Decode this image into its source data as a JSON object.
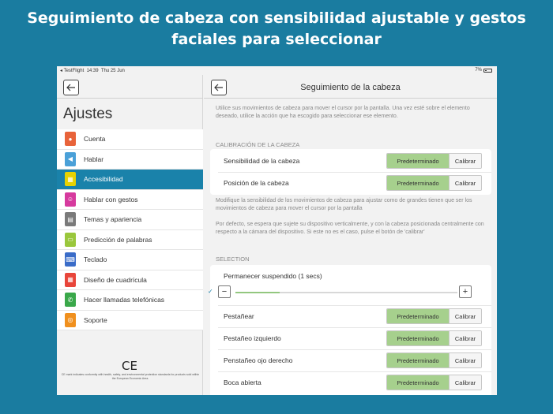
{
  "headline": {
    "line1": "Seguimiento de cabeza con sensibilidad ajustable y gestos",
    "line2": "faciales para seleccionar"
  },
  "statusbar": {
    "app": "◂ TestFlight",
    "time": "14:39",
    "date": "Thu 25 Jun",
    "battery": "7%"
  },
  "sidebar": {
    "title": "Ajustes",
    "items": [
      {
        "label": "Cuenta",
        "icon": "person-icon",
        "color": "#e8633a"
      },
      {
        "label": "Hablar",
        "icon": "speaker-icon",
        "color": "#4aa0d8"
      },
      {
        "label": "Accesibilidad",
        "icon": "grid-icon",
        "color": "#e8d200"
      },
      {
        "label": "Hablar con gestos",
        "icon": "gesture-icon",
        "color": "#d63a9e"
      },
      {
        "label": "Temas y apariencia",
        "icon": "theme-icon",
        "color": "#7a7a7a"
      },
      {
        "label": "Predicción de palabras",
        "icon": "prediction-icon",
        "color": "#9ac73c"
      },
      {
        "label": "Teclado",
        "icon": "keyboard-icon",
        "color": "#3a6cc8"
      },
      {
        "label": "Diseño de cuadrícula",
        "icon": "layout-icon",
        "color": "#e8453a"
      },
      {
        "label": "Hacer llamadas telefónicas",
        "icon": "phone-icon",
        "color": "#3aa84a"
      },
      {
        "label": "Soporte",
        "icon": "support-icon",
        "color": "#f0901e"
      }
    ],
    "active_index": 2,
    "ce_mark": "CE",
    "ce_text": "CE mark indicates conformity with health, safety, and environmental protection standards for products sold within the European Economic Area."
  },
  "detail": {
    "title": "Seguimiento de la cabeza",
    "intro": "Utilice sus movimientos de cabeza para mover el cursor por la pantalla. Una vez esté sobre el elemento deseado, utilice la acción que ha escogido para seleccionar ese elemento.",
    "calibration_header": "CALIBRACIÓN DE LA CABEZA",
    "calibration_rows": [
      {
        "label": "Sensibilidad de la cabeza",
        "opt_a": "Predeterminado",
        "opt_b": "Calibrar"
      },
      {
        "label": "Posición de la cabeza",
        "opt_a": "Predeterminado",
        "opt_b": "Calibrar"
      }
    ],
    "note1": "Modifique la sensibilidad de los movimientos de cabeza para ajustar como de grandes tienen que ser los movimientos de cabeza para mover el cursor por la pantalla",
    "note2": "Por defecto, se espera que sujete su dispositivo verticalmente, y con la cabeza posicionada centralmente con respecto a la cámara del dispositivo. Si este no es el caso, pulse el botón de 'calibrar'",
    "selection_header": "SELECTION",
    "dwell": {
      "label": "Permanecer suspendido (1 secs)",
      "value": 0.2,
      "check": "✓",
      "minus": "−",
      "plus": "+"
    },
    "gesture_rows": [
      {
        "label": "Pestañear",
        "opt_a": "Predeterminado",
        "opt_b": "Calibrar"
      },
      {
        "label": "Pestañeo izquierdo",
        "opt_a": "Predeterminado",
        "opt_b": "Calibrar"
      },
      {
        "label": "Penstañeo ojo derecho",
        "opt_a": "Predeterminado",
        "opt_b": "Calibrar"
      },
      {
        "label": "Boca abierta",
        "opt_a": "Predeterminado",
        "opt_b": "Calibrar"
      }
    ]
  },
  "colors": {
    "background": "#1a7ca0",
    "active": "#1a82aa",
    "selected_option": "#a6d08d"
  }
}
